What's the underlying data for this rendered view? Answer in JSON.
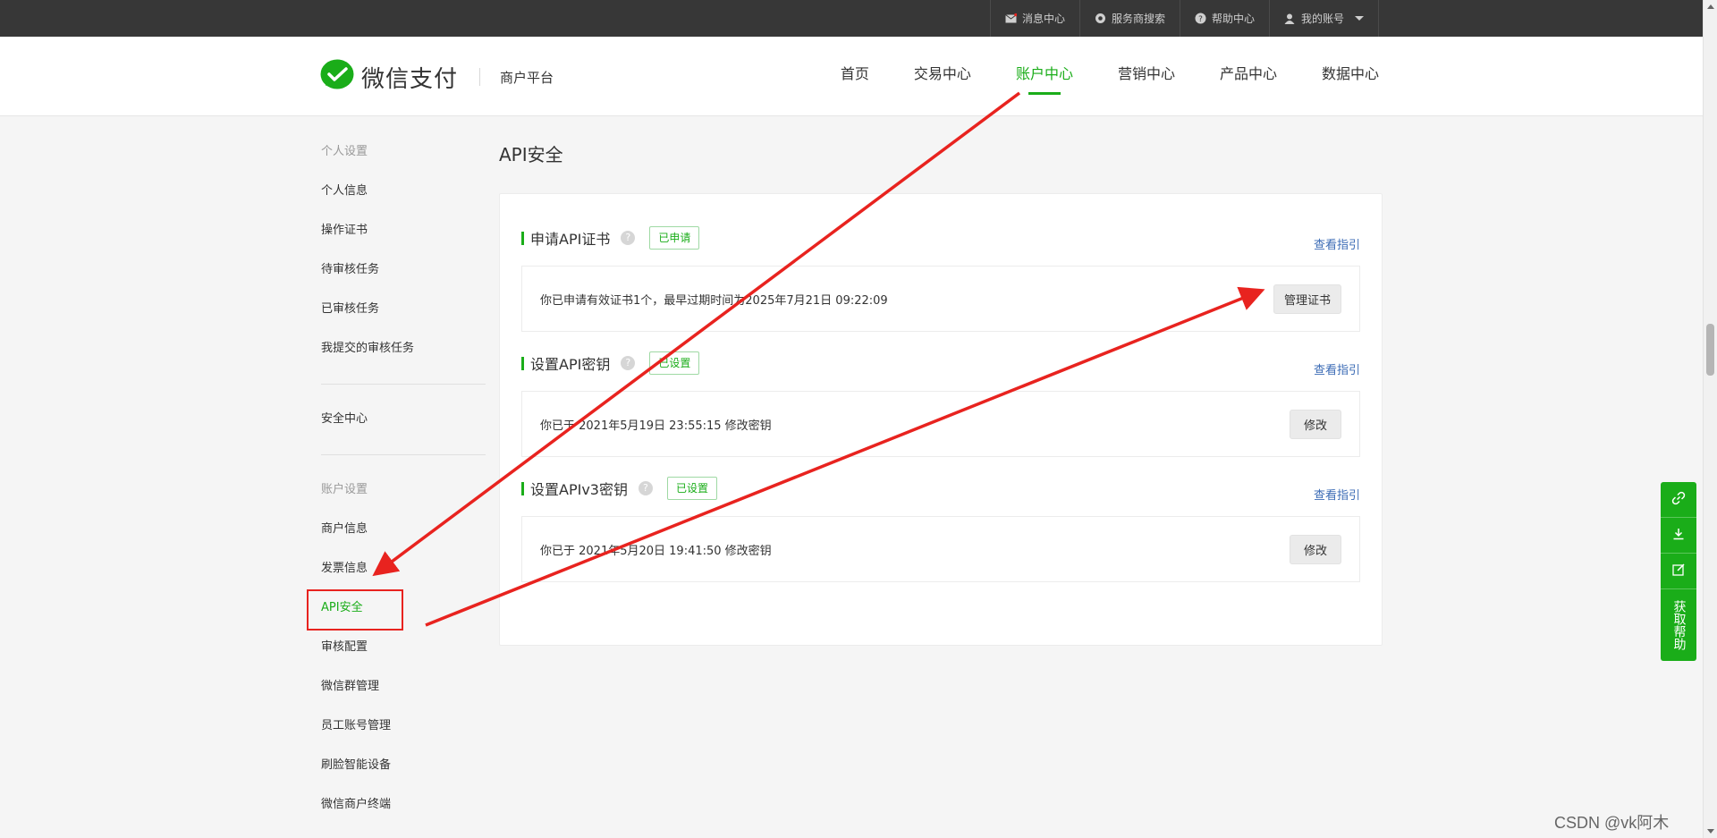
{
  "topbar": {
    "links": [
      {
        "icon": "mail-icon",
        "label": "消息中心"
      },
      {
        "icon": "search-gear-icon",
        "label": "服务商搜索"
      },
      {
        "icon": "help-icon",
        "label": "帮助中心"
      },
      {
        "icon": "user-icon",
        "label": "我的账号"
      }
    ]
  },
  "header": {
    "logo_text": "微信支付",
    "logo_sub": "商户平台",
    "nav": [
      {
        "label": "首页",
        "active": false
      },
      {
        "label": "交易中心",
        "active": false
      },
      {
        "label": "账户中心",
        "active": true
      },
      {
        "label": "营销中心",
        "active": false
      },
      {
        "label": "产品中心",
        "active": false
      },
      {
        "label": "数据中心",
        "active": false
      }
    ]
  },
  "sidebar": {
    "group1_title": "个人设置",
    "group1_items": [
      "个人信息",
      "操作证书",
      "待审核任务",
      "已审核任务",
      "我提交的审核任务"
    ],
    "security": "安全中心",
    "group2_title": "账户设置",
    "group2_items": [
      "商户信息",
      "发票信息",
      "API安全",
      "审核配置",
      "微信群管理",
      "员工账号管理",
      "刷脸智能设备",
      "微信商户终端"
    ],
    "active_item": "API安全"
  },
  "main": {
    "page_title": "API安全",
    "sections": [
      {
        "title": "申请API证书",
        "status": "已申请",
        "guide": "查看指引",
        "text": "你已申请有效证书1个，最早过期时间为2025年7月21日 09:22:09",
        "button": "管理证书"
      },
      {
        "title": "设置API密钥",
        "status": "已设置",
        "guide": "查看指引",
        "text": "你已于 2021年5月19日 23:55:15 修改密钥",
        "button": "修改"
      },
      {
        "title": "设置APIv3密钥",
        "status": "已设置",
        "guide": "查看指引",
        "text": "你已于 2021年5月20日 19:41:50 修改密钥",
        "button": "修改"
      }
    ]
  },
  "float_panel": {
    "icons": [
      "link-icon",
      "download-icon",
      "edit-icon"
    ],
    "help_label": "获取帮助"
  },
  "watermark": "CSDN @vk阿木",
  "colors": {
    "brand_green": "#1aad19",
    "topbar": "#373737",
    "annotation_red": "#e8231f",
    "link_blue": "#3b6bb5"
  }
}
